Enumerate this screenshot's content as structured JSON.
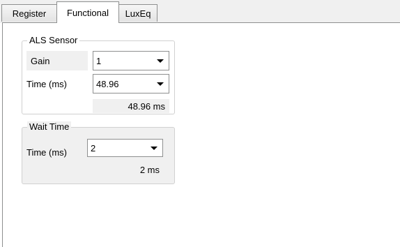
{
  "tabs": [
    {
      "label": "Register"
    },
    {
      "label": "Functional"
    },
    {
      "label": "LuxEq"
    }
  ],
  "als_sensor": {
    "title": "ALS Sensor",
    "gain_label": "Gain",
    "gain_value": "1",
    "time_label": "Time (ms)",
    "time_value": "48.96",
    "readout": "48.96 ms"
  },
  "wait_time": {
    "title": "Wait Time",
    "time_label": "Time (ms)",
    "time_value": "2",
    "readout": "2 ms"
  }
}
